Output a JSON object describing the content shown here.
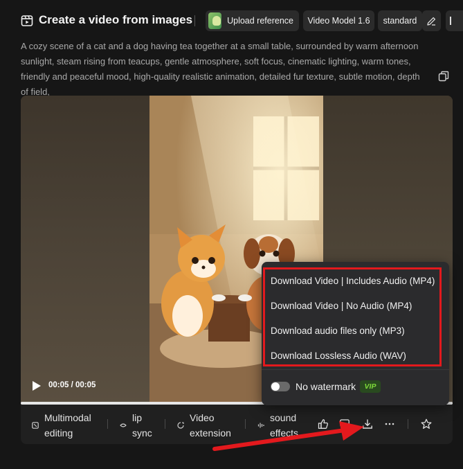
{
  "header": {
    "title": "Create a video from images",
    "upload_label": "Upload reference",
    "model_label": "Video Model 1.6",
    "quality_label": "standard"
  },
  "prompt": {
    "text": "A cozy scene of a cat and a dog having tea together at a small table, surrounded by warm afternoon sunlight, steam rising from teacups, gentle atmosphere, soft focus, cinematic lighting, warm tones, friendly and peaceful mood, high-quality realistic animation, detailed fur texture, subtle motion, depth of field,"
  },
  "player": {
    "time": "00:05 / 00:05",
    "progress_fraction": 1.0
  },
  "toolbar": {
    "tools": [
      {
        "label_line1": "Multimodal",
        "label_line2": "editing",
        "icon": "multimodal-icon"
      },
      {
        "label_line1": "lip",
        "label_line2": "sync",
        "icon": "lip-icon"
      },
      {
        "label_line1": "Video",
        "label_line2": "extension",
        "icon": "extension-icon"
      },
      {
        "label_line1": "sound",
        "label_line2": "effects",
        "icon": "sound-icon"
      }
    ]
  },
  "download_menu": {
    "items": [
      "Download Video | Includes Audio (MP4)",
      "Download Video | No Audio (MP4)",
      "Download audio files only (MP3)",
      "Download Lossless Audio (WAV)"
    ],
    "watermark_label": "No watermark",
    "watermark_enabled": false,
    "vip_badge": "VIP"
  },
  "colors": {
    "highlight": "#e3191d",
    "vip_text": "#7fdc3a",
    "background": "#161616"
  }
}
